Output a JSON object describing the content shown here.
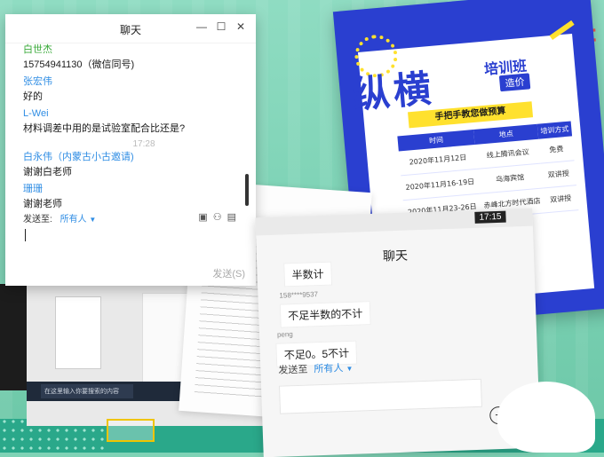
{
  "background": {
    "accent": "#7fd3b6",
    "deco_text": "right"
  },
  "poster": {
    "title": "纵横",
    "subtitle": "培训班",
    "tag": "造价",
    "slogan": "手把手教您做预算",
    "table_headers": [
      "时间",
      "地点",
      "培训方式"
    ],
    "rows": [
      [
        "2020年11月12日",
        "线上腾讯会议",
        "免费"
      ],
      [
        "2020年11月16-19日",
        "乌海宾馆",
        "双讲授"
      ],
      [
        "2020年11月23-26日",
        "赤峰北方时代酒店",
        "双讲授"
      ]
    ]
  },
  "scanner": {
    "search_placeholder": "在这里输入你要搜索的内容"
  },
  "chat_window": {
    "title": "聊天",
    "controls": {
      "minimize": "—",
      "maximize": "☐",
      "close": "✕"
    },
    "messages": [
      {
        "sender": "白世杰",
        "text": "15754941130（微信同号)",
        "sender_color": "green"
      },
      {
        "sender": "张宏伟",
        "text": "好的",
        "sender_color": "blue"
      },
      {
        "sender": "L-Wei",
        "text": "材料调差中用的是试验室配合比还是?",
        "sender_color": "blue"
      },
      {
        "time": "17:28"
      },
      {
        "sender": "白永伟（内蒙古小古邀请)",
        "text": "谢谢白老师",
        "sender_color": "blue"
      },
      {
        "sender": "珊珊",
        "text": "谢谢老师",
        "sender_color": "blue"
      }
    ],
    "send_to_label": "发送至:",
    "send_to_value": "所有人",
    "send_button": "发送(S)"
  },
  "phone_chat": {
    "status_time": "17:15",
    "title": "聊天",
    "messages": [
      {
        "sender": "",
        "text": "半数计"
      },
      {
        "sender": "158****9537",
        "text": "不足半数的不计"
      },
      {
        "sender": "peng",
        "text": "不足0。5不计"
      }
    ],
    "send_to_label": "发送至",
    "send_to_value": "所有人",
    "plus_label": "+"
  }
}
